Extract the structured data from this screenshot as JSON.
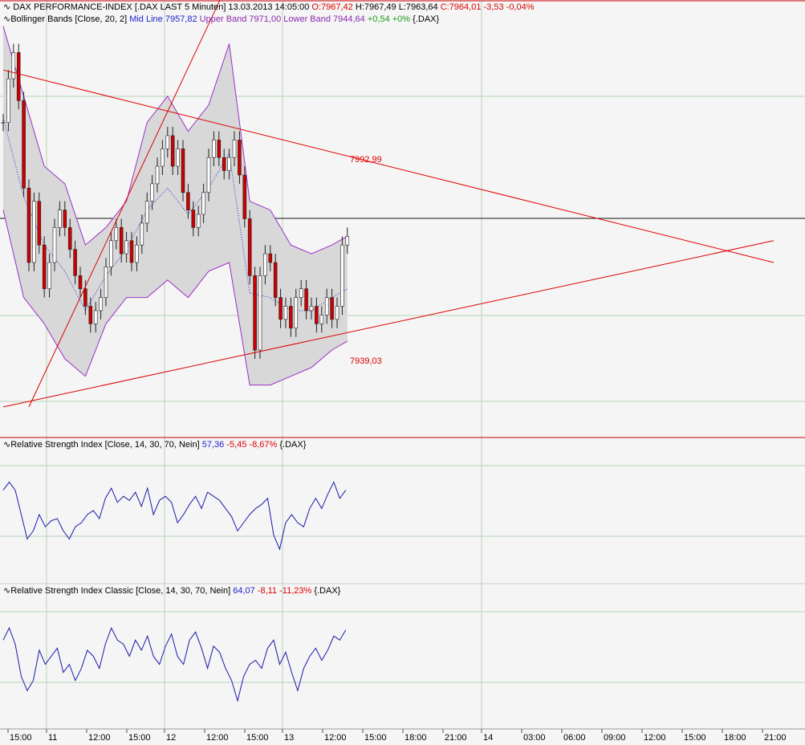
{
  "colors": {
    "background": "#f5f5f5",
    "grid": "#b8d4b8",
    "trend": "#dd0000",
    "band": "#9b30c8",
    "mid": "#2020d0",
    "candle_up": "#ffffff",
    "candle_down": "#cc0000",
    "rsi": "#1a1aaa",
    "text_blue": "#2020d0",
    "text_red": "#dd0000",
    "text_green": "#1a9a1a",
    "text_purple": "#8a2ab0"
  },
  "header": {
    "icon": "line-chart-icon",
    "title": "DAX PERFORMANCE-INDEX [.DAX LAST 5 Minuten] 13.03.2013 14:05:00",
    "open": "O:7967,42",
    "high": "H:7967,49",
    "low": "L:7963,64",
    "close": "C:7964,01",
    "change": "-3,53",
    "change_pct": "-0,04%"
  },
  "bollinger": {
    "icon": "line-chart-icon",
    "label": "Bollinger Bands [Close, 20, 2]",
    "mid_label": "Mid Line 7957,82",
    "upper_label": "Upper Band 7971,00",
    "lower_label": "Lower Band 7944,64",
    "change": "+0,54 +0%",
    "symbol": "{.DAX}"
  },
  "rsi": {
    "icon": "line-chart-icon",
    "label": "Relative Strength Index [Close, 14, 30, 70, Nein]",
    "value": "57,36",
    "change": "-5,45 -8,67%",
    "symbol": "{.DAX}"
  },
  "rsi_classic": {
    "icon": "line-chart-icon",
    "label": "Relative Strength Index Classic [Close, 14, 30, 70, Nein]",
    "value": "64,07",
    "change": "-8,11 -11,23%",
    "symbol": "{.DAX}"
  },
  "annotations": {
    "upper_level": "7992,99",
    "lower_level": "7939,03"
  },
  "chart_data": {
    "type": "line",
    "x_ticks": [
      "15:00",
      "11",
      "12:00",
      "15:00",
      "12",
      "12:00",
      "15:00",
      "13",
      "12:00",
      "15:00",
      "18:00",
      "21:00",
      "14",
      "03:00",
      "06:00",
      "09:00",
      "12:00",
      "15:00",
      "18:00",
      "21:00"
    ],
    "price_series": {
      "name": "DAX PERFORMANCE-INDEX",
      "points": [
        [
          0,
          7990
        ],
        [
          1,
          8000
        ],
        [
          2,
          8006
        ],
        [
          3,
          7995
        ],
        [
          4,
          7975
        ],
        [
          5,
          7958
        ],
        [
          6,
          7972
        ],
        [
          7,
          7962
        ],
        [
          8,
          7952
        ],
        [
          9,
          7958
        ],
        [
          10,
          7966
        ],
        [
          11,
          7970
        ],
        [
          12,
          7966
        ],
        [
          13,
          7961
        ],
        [
          14,
          7955
        ],
        [
          15,
          7952
        ],
        [
          16,
          7948
        ],
        [
          17,
          7944
        ],
        [
          18,
          7947
        ],
        [
          19,
          7950
        ],
        [
          20,
          7957
        ],
        [
          21,
          7963
        ],
        [
          22,
          7966
        ],
        [
          23,
          7960
        ],
        [
          24,
          7963
        ],
        [
          25,
          7958
        ],
        [
          26,
          7962
        ],
        [
          27,
          7967
        ],
        [
          28,
          7972
        ],
        [
          29,
          7976
        ],
        [
          30,
          7980
        ],
        [
          31,
          7984
        ],
        [
          32,
          7987
        ],
        [
          33,
          7980
        ],
        [
          34,
          7984
        ],
        [
          35,
          7974
        ],
        [
          36,
          7970
        ],
        [
          37,
          7966
        ],
        [
          38,
          7969
        ],
        [
          39,
          7974
        ],
        [
          40,
          7982
        ],
        [
          41,
          7986
        ],
        [
          42,
          7982
        ],
        [
          43,
          7979
        ],
        [
          44,
          7982
        ],
        [
          45,
          7986
        ],
        [
          46,
          7978
        ],
        [
          47,
          7968
        ],
        [
          48,
          7955
        ],
        [
          49,
          7938
        ],
        [
          50,
          7955
        ],
        [
          51,
          7960
        ],
        [
          52,
          7958
        ],
        [
          53,
          7950
        ],
        [
          54,
          7945
        ],
        [
          55,
          7948
        ],
        [
          56,
          7943
        ],
        [
          57,
          7950
        ],
        [
          58,
          7952
        ],
        [
          59,
          7947
        ],
        [
          60,
          7948
        ],
        [
          61,
          7944
        ],
        [
          62,
          7946
        ],
        [
          63,
          7950
        ],
        [
          64,
          7945
        ],
        [
          65,
          7948
        ],
        [
          66,
          7962
        ],
        [
          67,
          7964
        ]
      ]
    },
    "rsi_series": {
      "name": "Relative Strength Index",
      "points": [
        [
          0,
          62
        ],
        [
          1,
          66
        ],
        [
          2,
          62
        ],
        [
          3,
          50
        ],
        [
          4,
          38
        ],
        [
          5,
          42
        ],
        [
          6,
          50
        ],
        [
          7,
          44
        ],
        [
          8,
          47
        ],
        [
          9,
          48
        ],
        [
          10,
          42
        ],
        [
          11,
          38
        ],
        [
          12,
          44
        ],
        [
          13,
          46
        ],
        [
          14,
          50
        ],
        [
          15,
          52
        ],
        [
          16,
          48
        ],
        [
          17,
          58
        ],
        [
          18,
          63
        ],
        [
          19,
          56
        ],
        [
          20,
          59
        ],
        [
          21,
          57
        ],
        [
          22,
          61
        ],
        [
          23,
          54
        ],
        [
          24,
          63
        ],
        [
          25,
          50
        ],
        [
          26,
          57
        ],
        [
          27,
          59
        ],
        [
          28,
          56
        ],
        [
          29,
          46
        ],
        [
          30,
          50
        ],
        [
          31,
          55
        ],
        [
          32,
          59
        ],
        [
          33,
          53
        ],
        [
          34,
          61
        ],
        [
          35,
          59
        ],
        [
          36,
          57
        ],
        [
          37,
          53
        ],
        [
          38,
          49
        ],
        [
          39,
          42
        ],
        [
          40,
          46
        ],
        [
          41,
          50
        ],
        [
          42,
          53
        ],
        [
          43,
          55
        ],
        [
          44,
          58
        ],
        [
          45,
          40
        ],
        [
          46,
          33
        ],
        [
          47,
          46
        ],
        [
          48,
          50
        ],
        [
          49,
          46
        ],
        [
          50,
          44
        ],
        [
          51,
          53
        ],
        [
          52,
          58
        ],
        [
          53,
          53
        ],
        [
          54,
          60
        ],
        [
          55,
          66
        ],
        [
          56,
          58
        ],
        [
          57,
          62
        ]
      ]
    },
    "rsi_classic_series": {
      "name": "Relative Strength Index Classic",
      "points": [
        [
          0,
          60
        ],
        [
          1,
          66
        ],
        [
          2,
          58
        ],
        [
          3,
          42
        ],
        [
          4,
          35
        ],
        [
          5,
          40
        ],
        [
          6,
          55
        ],
        [
          7,
          48
        ],
        [
          8,
          52
        ],
        [
          9,
          56
        ],
        [
          10,
          44
        ],
        [
          11,
          48
        ],
        [
          12,
          40
        ],
        [
          13,
          46
        ],
        [
          14,
          55
        ],
        [
          15,
          52
        ],
        [
          16,
          46
        ],
        [
          17,
          58
        ],
        [
          18,
          66
        ],
        [
          19,
          60
        ],
        [
          20,
          58
        ],
        [
          21,
          52
        ],
        [
          22,
          60
        ],
        [
          23,
          55
        ],
        [
          24,
          62
        ],
        [
          25,
          52
        ],
        [
          26,
          48
        ],
        [
          27,
          57
        ],
        [
          28,
          63
        ],
        [
          29,
          52
        ],
        [
          30,
          48
        ],
        [
          31,
          60
        ],
        [
          32,
          64
        ],
        [
          33,
          56
        ],
        [
          34,
          46
        ],
        [
          35,
          57
        ],
        [
          36,
          54
        ],
        [
          37,
          46
        ],
        [
          38,
          40
        ],
        [
          39,
          30
        ],
        [
          40,
          42
        ],
        [
          41,
          48
        ],
        [
          42,
          50
        ],
        [
          43,
          46
        ],
        [
          44,
          56
        ],
        [
          45,
          60
        ],
        [
          46,
          48
        ],
        [
          47,
          54
        ],
        [
          48,
          44
        ],
        [
          49,
          35
        ],
        [
          50,
          46
        ],
        [
          51,
          52
        ],
        [
          52,
          56
        ],
        [
          53,
          50
        ],
        [
          54,
          55
        ],
        [
          55,
          62
        ],
        [
          56,
          60
        ],
        [
          57,
          65
        ]
      ]
    },
    "bollinger_upper": [
      [
        0,
        8012
      ],
      [
        4,
        7996
      ],
      [
        8,
        7980
      ],
      [
        12,
        7976
      ],
      [
        16,
        7962
      ],
      [
        20,
        7966
      ],
      [
        24,
        7972
      ],
      [
        28,
        7990
      ],
      [
        32,
        7996
      ],
      [
        36,
        7988
      ],
      [
        40,
        7994
      ],
      [
        44,
        8008
      ],
      [
        48,
        7972
      ],
      [
        52,
        7970
      ],
      [
        56,
        7962
      ],
      [
        60,
        7960
      ],
      [
        64,
        7962
      ],
      [
        67,
        7964
      ]
    ],
    "bollinger_lower": [
      [
        0,
        7970
      ],
      [
        4,
        7950
      ],
      [
        8,
        7944
      ],
      [
        12,
        7936
      ],
      [
        16,
        7932
      ],
      [
        20,
        7944
      ],
      [
        24,
        7950
      ],
      [
        28,
        7950
      ],
      [
        32,
        7954
      ],
      [
        36,
        7950
      ],
      [
        40,
        7956
      ],
      [
        44,
        7958
      ],
      [
        48,
        7930
      ],
      [
        52,
        7930
      ],
      [
        56,
        7932
      ],
      [
        60,
        7934
      ],
      [
        64,
        7938
      ],
      [
        67,
        7940
      ]
    ],
    "trend_lines": [
      {
        "from": [
          0,
          8002
        ],
        "to": [
          150,
          7958
        ]
      },
      {
        "from": [
          0,
          7925
        ],
        "to": [
          150,
          7963
        ]
      },
      {
        "from": [
          5,
          7925
        ],
        "to": [
          45,
          8025
        ]
      }
    ]
  }
}
